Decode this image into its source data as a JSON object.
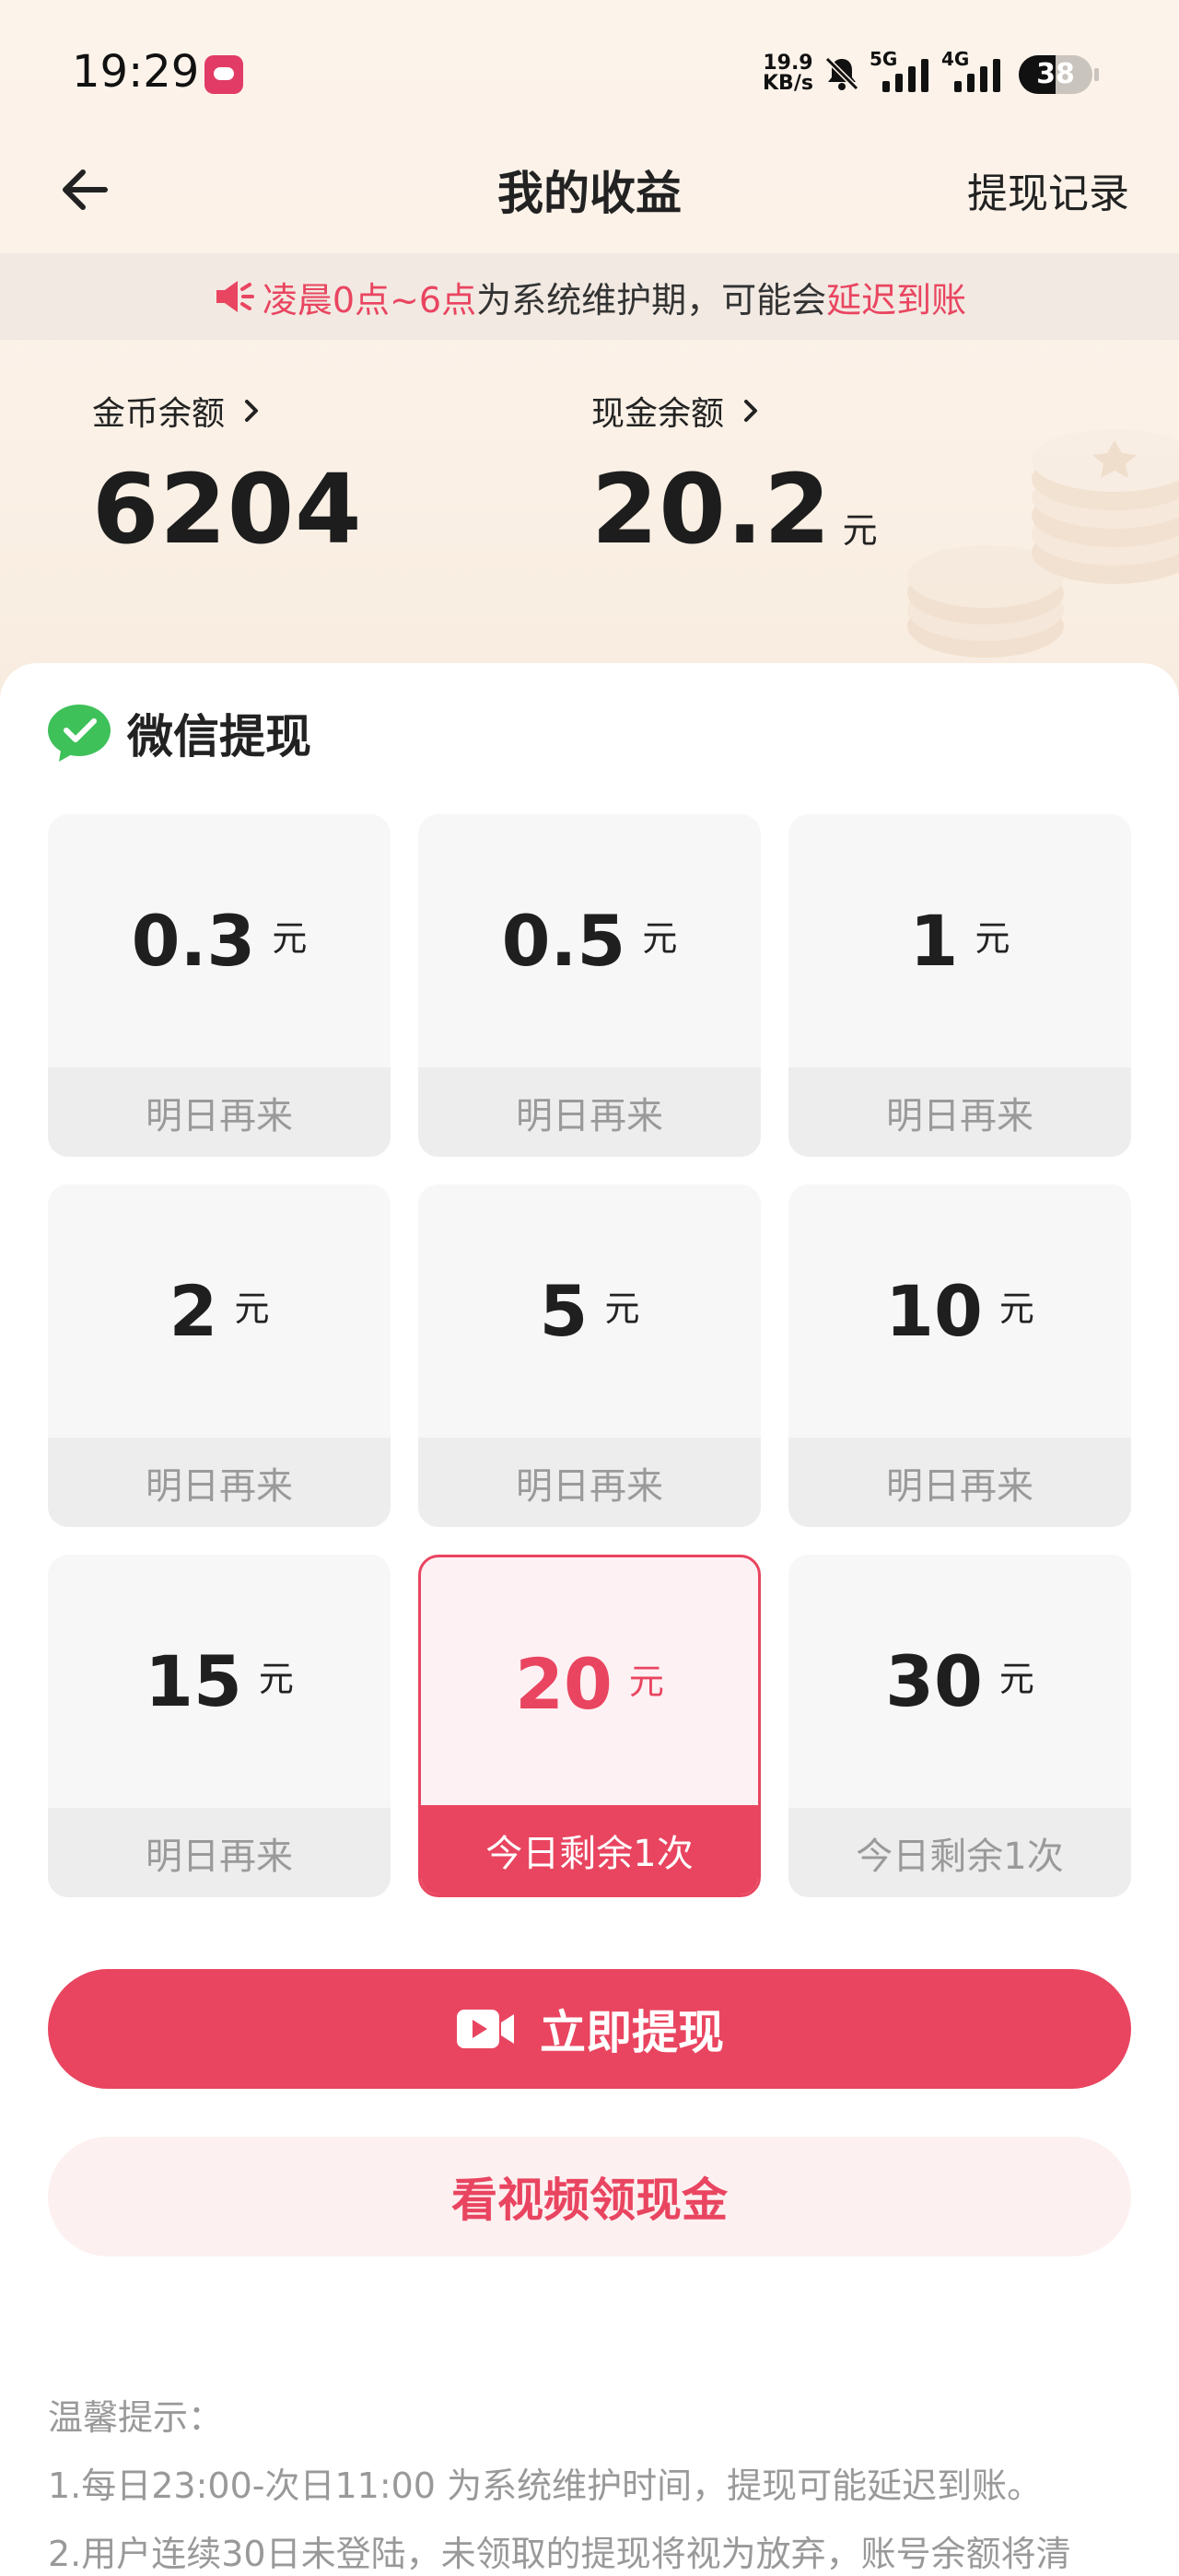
{
  "status_bar": {
    "time": "19:29",
    "net_speed_value": "19.9",
    "net_speed_unit": "KB/s",
    "sim1_label": "5G",
    "sim2_label": "4G",
    "battery": "38"
  },
  "header": {
    "title": "我的收益",
    "right_link": "提现记录"
  },
  "notice": {
    "part1": "凌晨0点~6点",
    "part2": "为系统维护期，可能会",
    "part3": "延迟到账"
  },
  "balances": {
    "coin_label": "金币余额",
    "coin_value": "6204",
    "cash_label": "现金余额",
    "cash_value": "20.2",
    "cash_unit": "元"
  },
  "withdraw": {
    "channel_label": "微信提现",
    "options": [
      {
        "amount": "0.3",
        "unit": "元",
        "status": "明日再来"
      },
      {
        "amount": "0.5",
        "unit": "元",
        "status": "明日再来"
      },
      {
        "amount": "1",
        "unit": "元",
        "status": "明日再来"
      },
      {
        "amount": "2",
        "unit": "元",
        "status": "明日再来"
      },
      {
        "amount": "5",
        "unit": "元",
        "status": "明日再来"
      },
      {
        "amount": "10",
        "unit": "元",
        "status": "明日再来"
      },
      {
        "amount": "15",
        "unit": "元",
        "status": "明日再来"
      },
      {
        "amount": "20",
        "unit": "元",
        "status": "今日剩余1次"
      },
      {
        "amount": "30",
        "unit": "元",
        "status": "今日剩余1次"
      }
    ],
    "selected_index": 7,
    "primary_button": "立即提现",
    "secondary_button": "看视频领现金"
  },
  "tips": {
    "title": "温馨提示：",
    "lines": [
      "1.每日23:00-次日11:00 为系统维护时间，提现可能延迟到账。",
      "2.用户连续30日未登陆，未领取的提现将视为放弃，账号余额将清"
    ]
  },
  "colors": {
    "accent": "#e94560",
    "header_bg": "#fcf3ea",
    "notice_bg": "#f2e9e2",
    "wechat_green": "#3fc15a"
  }
}
